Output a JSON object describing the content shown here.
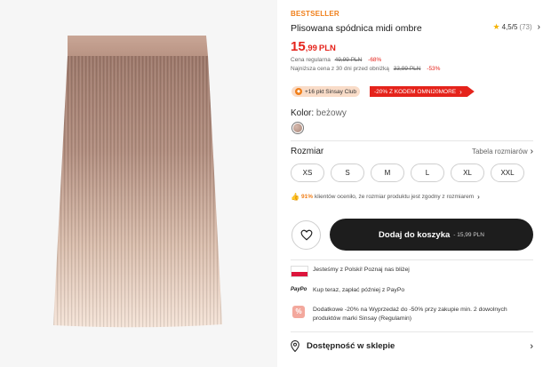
{
  "product": {
    "badge": "BESTSELLER",
    "title": "Plisowana spódnica midi ombre",
    "rating": "4,5/5",
    "review_count": "(73)",
    "price_int": "15",
    "price_dec": ",99",
    "currency": "PLN",
    "regular_label": "Cena regularna",
    "regular_price": "49,99 PLN",
    "regular_discount": "-68%",
    "lowest_label": "Najniższa cena z 30 dni przed obniżką",
    "lowest_price": "33,99 PLN",
    "lowest_discount": "-53%"
  },
  "promos": {
    "club": "+16 pkt Sinsay Club",
    "code": "-20% Z KODEM OMNI20MORE"
  },
  "color": {
    "label": "Kolor:",
    "value": "beżowy"
  },
  "size": {
    "label": "Rozmiar",
    "table_link": "Tabela rozmiarów",
    "options": [
      "XS",
      "S",
      "M",
      "L",
      "XL",
      "XXL"
    ],
    "fit_percent": "91%",
    "fit_text": "klientów oceniło, że rozmiar produktu jest zgodny z rozmiarem"
  },
  "cart": {
    "label": "Dodaj do koszyka",
    "price": "- 15,99 PLN"
  },
  "info": {
    "polish": "Jesteśmy z Polski! Poznaj nas bliżej",
    "paypo_logo": "PayPo",
    "paypo": "Kup teraz, zapłać później z PayPo",
    "extra": "Dodatkowe -20% na Wyprzedaż do -50% przy zakupie min. 2 dowolnych produktów marki Sinsay (Regulamin)"
  },
  "store": {
    "label": "Dostępność w sklepie"
  },
  "colors": {
    "accent_orange": "#f07f1a",
    "sale_red": "#e5231b",
    "cart_button": "#1d1d1d",
    "skirt_top": "#a47f72",
    "skirt_bottom": "#f3dfd2"
  },
  "icons": [
    "star-icon",
    "chevron-right-icon",
    "club-icon",
    "heart-icon",
    "poland-flag-icon",
    "paypo-logo",
    "gift-percent-icon",
    "location-pin-icon",
    "thumbs-up-icon"
  ]
}
